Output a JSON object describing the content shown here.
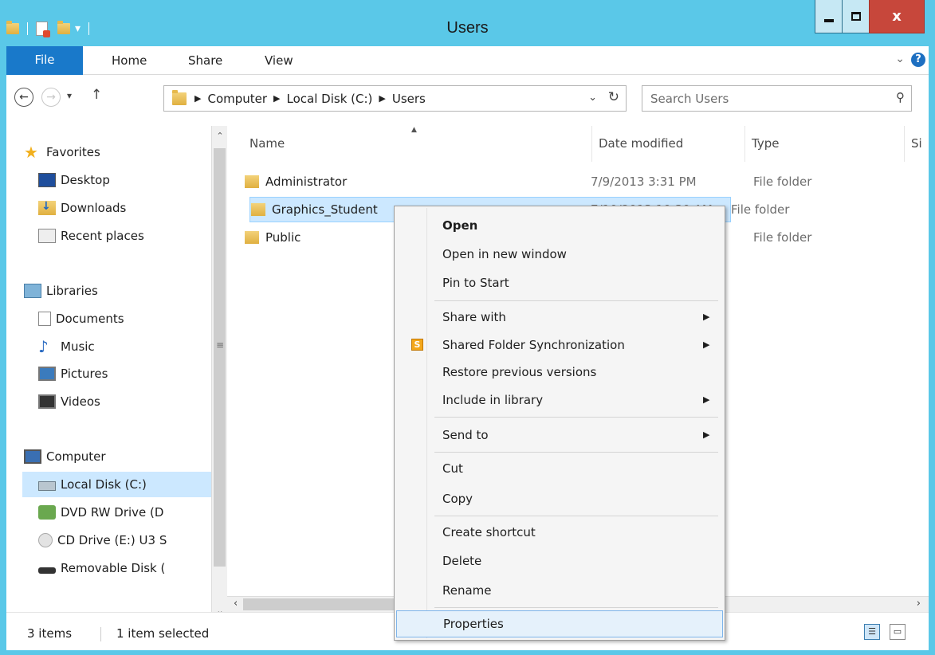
{
  "window": {
    "title": "Users",
    "close_glyph": "x"
  },
  "ribbon": {
    "tabs": [
      {
        "label": "File"
      },
      {
        "label": "Home"
      },
      {
        "label": "Share"
      },
      {
        "label": "View"
      }
    ],
    "help_glyph": "?"
  },
  "address": {
    "crumbs": [
      "Computer",
      "Local Disk (C:)",
      "Users"
    ]
  },
  "search": {
    "placeholder": "Search Users"
  },
  "nav": {
    "favorites": "Favorites",
    "favorites_items": [
      "Desktop",
      "Downloads",
      "Recent places"
    ],
    "libraries": "Libraries",
    "libraries_items": [
      "Documents",
      "Music",
      "Pictures",
      "Videos"
    ],
    "computer": "Computer",
    "computer_items": [
      "Local Disk (C:)",
      "DVD RW Drive (D",
      "CD Drive (E:) U3 S",
      "Removable Disk ("
    ]
  },
  "columns": {
    "name": "Name",
    "date": "Date modified",
    "type": "Type",
    "size": "Si"
  },
  "files": [
    {
      "name": "Administrator",
      "date": "7/9/2013 3:31 PM",
      "type": "File folder"
    },
    {
      "name": "Graphics_Student",
      "date": "7/10/2013 10:30 AM",
      "type": "File folder"
    },
    {
      "name": "Public",
      "date": "",
      "type": "File folder"
    }
  ],
  "context_menu": {
    "items": [
      {
        "label": "Open"
      },
      {
        "label": "Open in new window"
      },
      {
        "label": "Pin to Start"
      },
      {
        "label": "Share with"
      },
      {
        "label": "Shared Folder Synchronization",
        "icon_glyph": "S"
      },
      {
        "label": "Restore previous versions"
      },
      {
        "label": "Include in library"
      },
      {
        "label": "Send to"
      },
      {
        "label": "Cut"
      },
      {
        "label": "Copy"
      },
      {
        "label": "Create shortcut"
      },
      {
        "label": "Delete"
      },
      {
        "label": "Rename"
      },
      {
        "label": "Properties"
      }
    ]
  },
  "status": {
    "item_count": "3 items",
    "selection": "1 item selected"
  },
  "colors": {
    "titlebar": "#5ac8e8",
    "file_tab": "#1979ca",
    "selection": "#cce8ff",
    "close_button": "#c7473b"
  },
  "icons": {
    "favorites": "star-icon",
    "desktop": "desktop-icon",
    "downloads": "downloads-folder-icon",
    "recent": "recent-places-icon",
    "libraries": "libraries-icon",
    "documents": "document-icon",
    "music": "music-note-icon",
    "pictures": "pictures-icon",
    "videos": "video-film-icon",
    "computer": "computer-icon",
    "local_disk": "hard-disk-icon",
    "dvd": "dvd-drive-icon",
    "cd": "cd-drive-icon",
    "removable": "removable-disk-icon"
  }
}
